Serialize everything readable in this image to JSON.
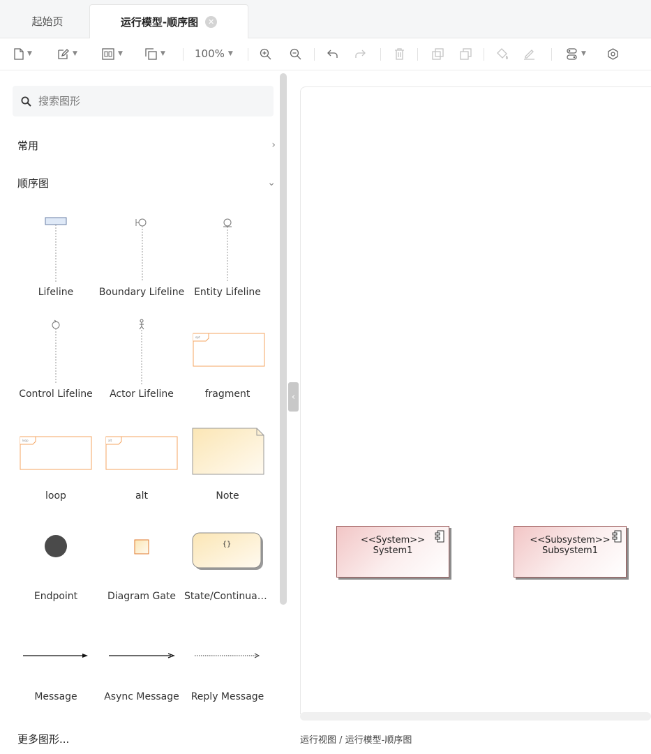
{
  "tabs": [
    {
      "label": "起始页"
    },
    {
      "label": "运行模型-顺序图",
      "close": "✕"
    }
  ],
  "toolbar": {
    "zoom": "100%"
  },
  "sidebar": {
    "search_placeholder": "搜索图形",
    "sections": [
      {
        "label": "常用",
        "chevron": "›"
      },
      {
        "label": "顺序图",
        "chevron": "⌄"
      }
    ],
    "shapes": [
      {
        "label": "Lifeline"
      },
      {
        "label": "Boundary Lifeline"
      },
      {
        "label": "Entity Lifeline"
      },
      {
        "label": "Control Lifeline"
      },
      {
        "label": "Actor Lifeline"
      },
      {
        "label": "fragment"
      },
      {
        "label": "loop"
      },
      {
        "label": "alt"
      },
      {
        "label": "Note"
      },
      {
        "label": "Endpoint"
      },
      {
        "label": "Diagram Gate"
      },
      {
        "label": "State/Continuation"
      },
      {
        "label": "Message"
      },
      {
        "label": "Async Message"
      },
      {
        "label": "Reply Message"
      }
    ],
    "more": "更多图形..."
  },
  "canvas": {
    "blocks": [
      {
        "stereotype": "<<System>>",
        "name": "System1"
      },
      {
        "stereotype": "<<Subsystem>>",
        "name": "Subsystem1"
      }
    ]
  },
  "breadcrumb": "运行视图 / 运行模型-顺序图",
  "colors": {
    "block_fill": "#f2c6c6",
    "block_border": "#9b5c5c",
    "note_fill": "#fdf0d0",
    "fragment_border": "#f4a460"
  }
}
